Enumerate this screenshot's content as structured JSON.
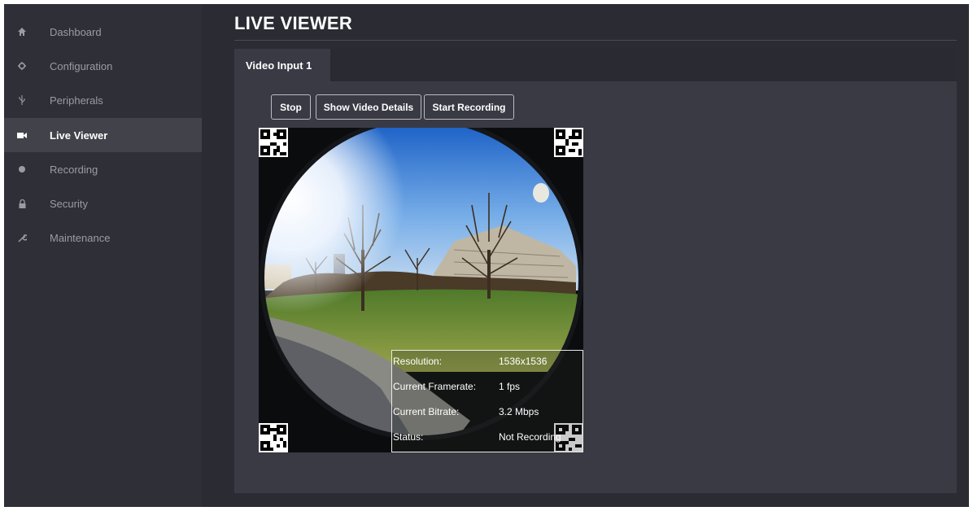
{
  "sidebar": {
    "items": [
      {
        "label": "Dashboard",
        "icon": "home-icon",
        "active": false
      },
      {
        "label": "Configuration",
        "icon": "gear-icon",
        "active": false
      },
      {
        "label": "Peripherals",
        "icon": "usb-icon",
        "active": false
      },
      {
        "label": "Live Viewer",
        "icon": "camera-icon",
        "active": true
      },
      {
        "label": "Recording",
        "icon": "record-dot-icon",
        "active": false
      },
      {
        "label": "Security",
        "icon": "lock-icon",
        "active": false
      },
      {
        "label": "Maintenance",
        "icon": "wrench-icon",
        "active": false
      }
    ]
  },
  "header": {
    "title": "LIVE VIEWER"
  },
  "tabs": [
    {
      "label": "Video Input 1"
    }
  ],
  "toolbar": {
    "stop_label": "Stop",
    "details_label": "Show Video Details",
    "record_label": "Start Recording"
  },
  "video_details": {
    "resolution_label": "Resolution:",
    "resolution_value": "1536x1536",
    "framerate_label": "Current Framerate:",
    "framerate_value": "1 fps",
    "bitrate_label": "Current Bitrate:",
    "bitrate_value": "3.2 Mbps",
    "status_label": "Status:",
    "status_value": "Not Recording"
  },
  "colors": {
    "background": "#2b2c33",
    "sidebar": "#2f3037",
    "active_item": "#41424a",
    "panel": "#393a43"
  }
}
